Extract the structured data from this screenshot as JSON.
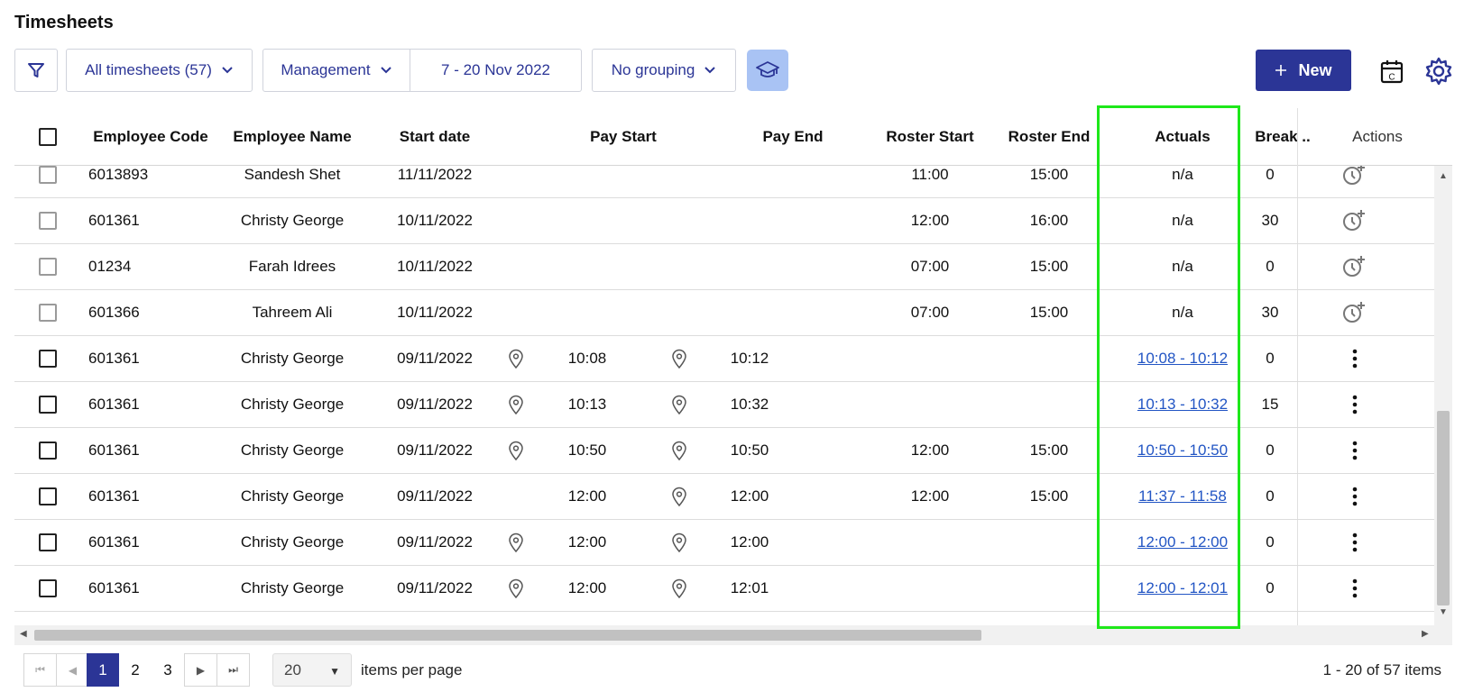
{
  "page": {
    "title": "Timesheets"
  },
  "toolbar": {
    "filter_dropdown": "All timesheets (57)",
    "location_dropdown": "Management",
    "date_range": "7 - 20 Nov 2022",
    "grouping_dropdown": "No grouping",
    "new_button": "New"
  },
  "columns": {
    "employee_code": "Employee Code",
    "employee_name": "Employee Name",
    "start_date": "Start date",
    "pay_start": "Pay Start",
    "pay_end": "Pay End",
    "roster_start": "Roster Start",
    "roster_end": "Roster End",
    "actuals": "Actuals",
    "break": "Break ..",
    "actions": "Actions"
  },
  "rows": [
    {
      "code": "6013893",
      "name": "Sandesh Shet",
      "date": "11/11/2022",
      "pay_start": "",
      "pay_end": "",
      "roster_start": "11:00",
      "roster_end": "15:00",
      "actuals": "n/a",
      "break": "0",
      "pin_start": false,
      "pin_end": false,
      "pending": true
    },
    {
      "code": "601361",
      "name": "Christy George",
      "date": "10/11/2022",
      "pay_start": "",
      "pay_end": "",
      "roster_start": "12:00",
      "roster_end": "16:00",
      "actuals": "n/a",
      "break": "30",
      "pin_start": false,
      "pin_end": false,
      "pending": true
    },
    {
      "code": "01234",
      "name": "Farah Idrees",
      "date": "10/11/2022",
      "pay_start": "",
      "pay_end": "",
      "roster_start": "07:00",
      "roster_end": "15:00",
      "actuals": "n/a",
      "break": "0",
      "pin_start": false,
      "pin_end": false,
      "pending": true
    },
    {
      "code": "601366",
      "name": "Tahreem Ali",
      "date": "10/11/2022",
      "pay_start": "",
      "pay_end": "",
      "roster_start": "07:00",
      "roster_end": "15:00",
      "actuals": "n/a",
      "break": "30",
      "pin_start": false,
      "pin_end": false,
      "pending": true
    },
    {
      "code": "601361",
      "name": "Christy George",
      "date": "09/11/2022",
      "pay_start": "10:08",
      "pay_end": "10:12",
      "roster_start": "",
      "roster_end": "",
      "actuals": "10:08 - 10:12",
      "break": "0",
      "pin_start": true,
      "pin_end": true,
      "pending": false
    },
    {
      "code": "601361",
      "name": "Christy George",
      "date": "09/11/2022",
      "pay_start": "10:13",
      "pay_end": "10:32",
      "roster_start": "",
      "roster_end": "",
      "actuals": "10:13 - 10:32",
      "break": "15",
      "pin_start": true,
      "pin_end": true,
      "pending": false
    },
    {
      "code": "601361",
      "name": "Christy George",
      "date": "09/11/2022",
      "pay_start": "10:50",
      "pay_end": "10:50",
      "roster_start": "12:00",
      "roster_end": "15:00",
      "actuals": "10:50 - 10:50",
      "break": "0",
      "pin_start": true,
      "pin_end": true,
      "pending": false
    },
    {
      "code": "601361",
      "name": "Christy George",
      "date": "09/11/2022",
      "pay_start": "12:00",
      "pay_end": "12:00",
      "roster_start": "12:00",
      "roster_end": "15:00",
      "actuals": "11:37 - 11:58",
      "break": "0",
      "pin_start": false,
      "pin_end": true,
      "pending": false
    },
    {
      "code": "601361",
      "name": "Christy George",
      "date": "09/11/2022",
      "pay_start": "12:00",
      "pay_end": "12:00",
      "roster_start": "",
      "roster_end": "",
      "actuals": "12:00 - 12:00",
      "break": "0",
      "pin_start": true,
      "pin_end": true,
      "pending": false
    },
    {
      "code": "601361",
      "name": "Christy George",
      "date": "09/11/2022",
      "pay_start": "12:00",
      "pay_end": "12:01",
      "roster_start": "",
      "roster_end": "",
      "actuals": "12:00 - 12:01",
      "break": "0",
      "pin_start": true,
      "pin_end": true,
      "pending": false
    }
  ],
  "pager": {
    "pages": [
      "1",
      "2",
      "3"
    ],
    "current_page": "1",
    "page_size": "20",
    "per_page_label": "items per page",
    "range_info": "1 - 20 of 57 items"
  },
  "colors": {
    "brand": "#2b3596",
    "link": "#2255c4",
    "highlight": "#1ee81a",
    "accent_light": "#a9c3f4"
  },
  "icons": [
    "filter-icon",
    "chevron-down-icon",
    "graduation-cap-icon",
    "plus-icon",
    "calendar-icon",
    "gear-icon",
    "location-pin-icon",
    "clock-plus-icon",
    "kebab-menu-icon"
  ]
}
